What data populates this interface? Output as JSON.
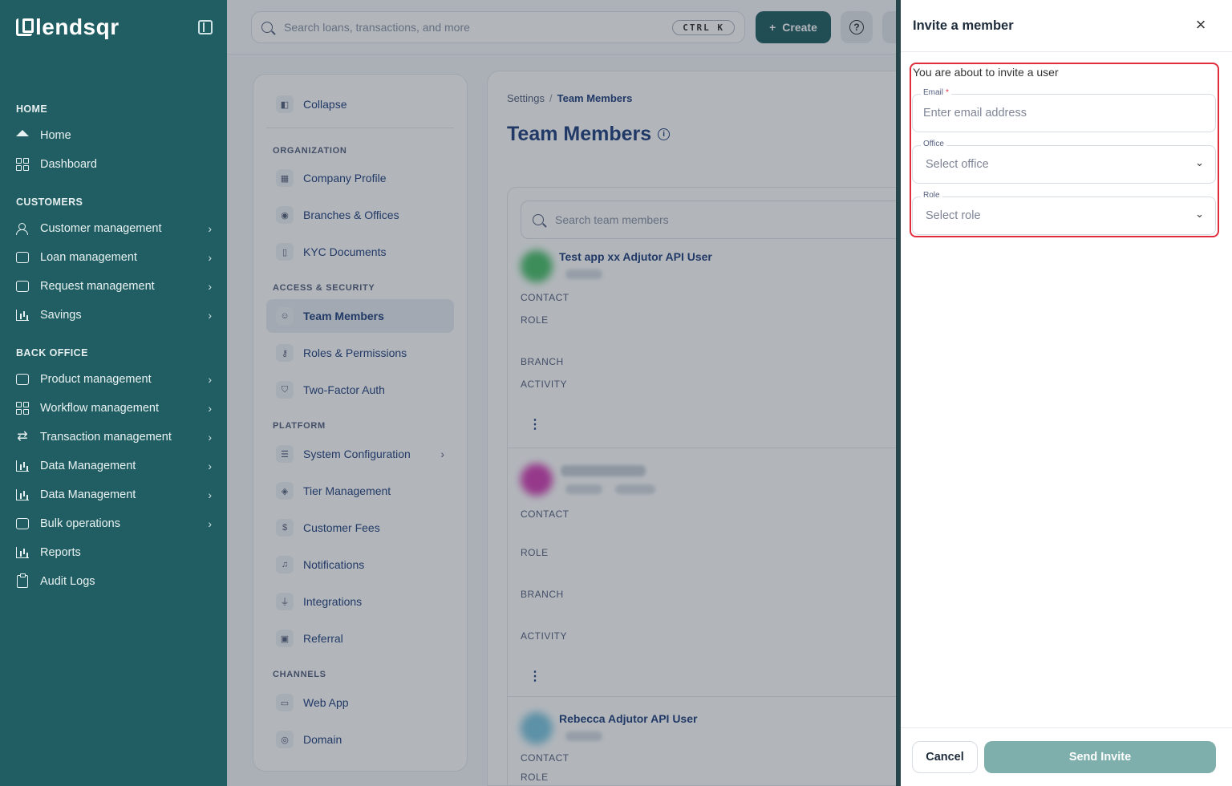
{
  "brand": {
    "name": "lendsqr",
    "sidebar_color": "#215e63",
    "accent": "#215e63"
  },
  "sidebar": {
    "collapse_icon": "sidebar-collapse-icon",
    "sections": [
      {
        "title": "HOME",
        "items": [
          {
            "label": "Home",
            "icon": "home-icon",
            "has_chevron": false
          },
          {
            "label": "Dashboard",
            "icon": "dashboard-icon",
            "has_chevron": false
          }
        ]
      },
      {
        "title": "CUSTOMERS",
        "items": [
          {
            "label": "Customer management",
            "icon": "users-icon",
            "has_chevron": true
          },
          {
            "label": "Loan management",
            "icon": "money-icon",
            "has_chevron": true
          },
          {
            "label": "Request management",
            "icon": "inbox-icon",
            "has_chevron": true
          },
          {
            "label": "Savings",
            "icon": "building-icon",
            "has_chevron": true
          }
        ]
      },
      {
        "title": "BACK OFFICE",
        "items": [
          {
            "label": "Product management",
            "icon": "box-icon",
            "has_chevron": true
          },
          {
            "label": "Workflow management",
            "icon": "workflow-icon",
            "has_chevron": true
          },
          {
            "label": "Transaction management",
            "icon": "transfer-icon",
            "has_chevron": true
          },
          {
            "label": "Data Management",
            "icon": "bar-chart-icon",
            "has_chevron": true
          },
          {
            "label": "Data Management",
            "icon": "bar-chart-icon",
            "has_chevron": true
          },
          {
            "label": "Bulk operations",
            "icon": "inbox-icon",
            "has_chevron": true
          },
          {
            "label": "Reports",
            "icon": "bar-chart-icon",
            "has_chevron": false
          },
          {
            "label": "Audit Logs",
            "icon": "clipboard-icon",
            "has_chevron": false
          }
        ]
      }
    ]
  },
  "topbar": {
    "search_placeholder": "Search loans, transactions, and more",
    "shortcut": "CTRL K",
    "create_label": "Create"
  },
  "settings_nav": {
    "collapse_label": "Collapse",
    "groups": [
      {
        "title": "ORGANIZATION",
        "items": [
          {
            "label": "Company Profile",
            "icon": "building-icon"
          },
          {
            "label": "Branches & Offices",
            "icon": "location-pin-icon"
          },
          {
            "label": "KYC Documents",
            "icon": "document-icon"
          }
        ]
      },
      {
        "title": "ACCESS & SECURITY",
        "items": [
          {
            "label": "Team Members",
            "icon": "users-icon",
            "active": true
          },
          {
            "label": "Roles & Permissions",
            "icon": "key-icon"
          },
          {
            "label": "Two-Factor Auth",
            "icon": "shield-icon"
          }
        ]
      },
      {
        "title": "PLATFORM",
        "items": [
          {
            "label": "System Configuration",
            "icon": "sliders-icon",
            "has_chevron": true
          },
          {
            "label": "Tier Management",
            "icon": "layers-icon"
          },
          {
            "label": "Customer Fees",
            "icon": "receipt-icon"
          },
          {
            "label": "Notifications",
            "icon": "bell-icon"
          },
          {
            "label": "Integrations",
            "icon": "plug-icon"
          },
          {
            "label": "Referral",
            "icon": "gift-icon"
          }
        ]
      },
      {
        "title": "CHANNELS",
        "items": [
          {
            "label": "Web App",
            "icon": "browser-icon"
          },
          {
            "label": "Domain",
            "icon": "globe-icon"
          }
        ]
      }
    ]
  },
  "main": {
    "breadcrumb": [
      "Settings",
      "Team Members"
    ],
    "title": "Team Members",
    "search_placeholder": "Search team members",
    "field_labels": {
      "contact": "CONTACT",
      "role": "ROLE",
      "branch": "BRANCH",
      "activity": "ACTIVITY"
    },
    "members": [
      {
        "name": "Test app xx Adjutor API User",
        "avatar_color": "#4bc06a"
      },
      {
        "name": "",
        "avatar_color": "#d43fb5"
      },
      {
        "name": "Rebecca Adjutor API User",
        "avatar_color": "#7cc6e0"
      }
    ]
  },
  "invite_panel": {
    "title": "Invite a member",
    "intro": "You are about to invite a user",
    "email": {
      "label": "Email",
      "required": true,
      "placeholder": "Enter email address",
      "value": ""
    },
    "office": {
      "label": "Office",
      "placeholder": "Select office"
    },
    "role": {
      "label": "Role",
      "placeholder": "Select role"
    },
    "cancel_label": "Cancel",
    "send_label": "Send Invite",
    "highlight_color": "#e02d3c"
  }
}
